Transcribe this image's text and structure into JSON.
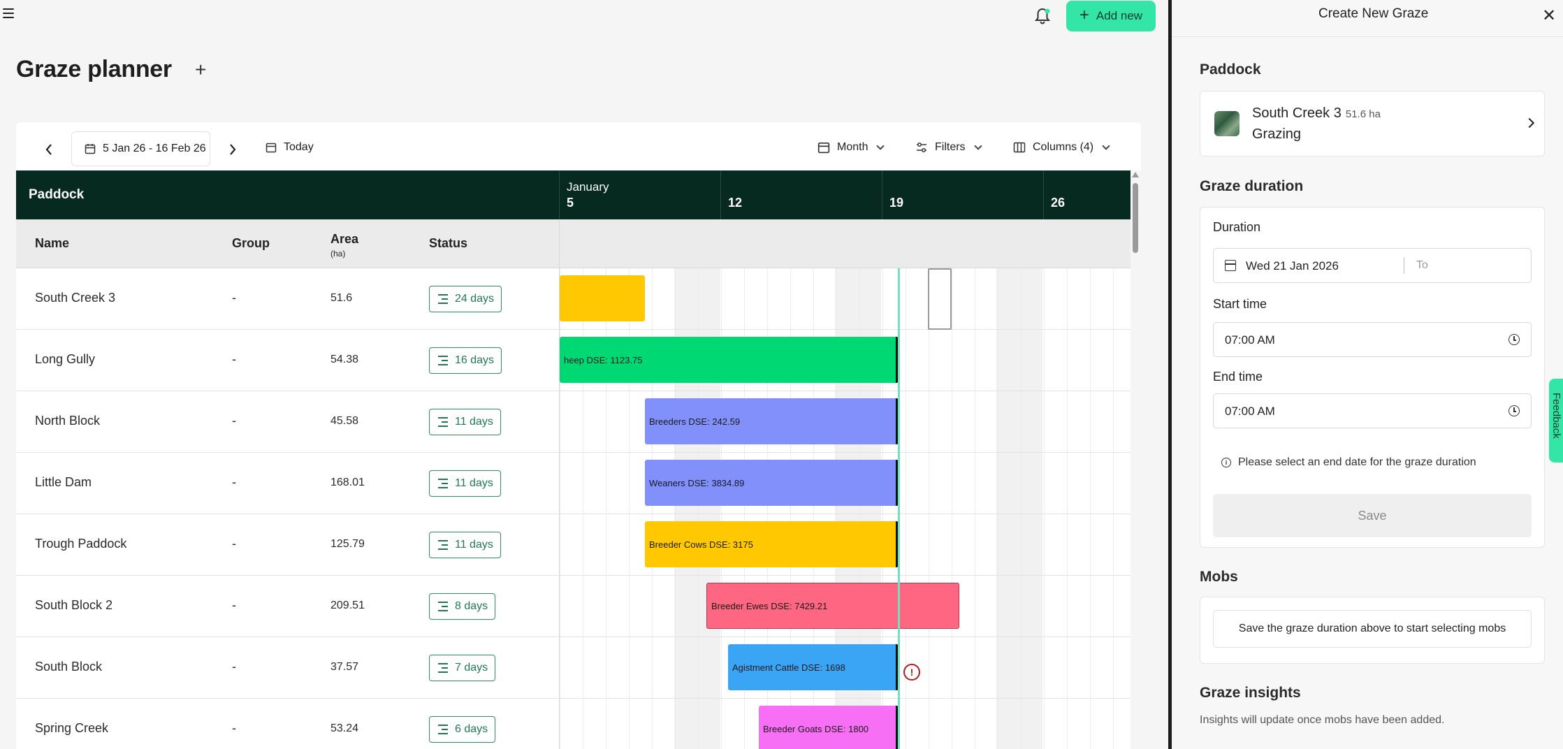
{
  "topbar": {
    "add_new_label": "Add new"
  },
  "page": {
    "title": "Graze planner"
  },
  "toolbar": {
    "date_range": "5 Jan 26 - 16 Feb 26",
    "today_label": "Today",
    "view_label": "Month",
    "filters_label": "Filters",
    "columns_label": "Columns (4)"
  },
  "grid": {
    "group_header": "Paddock",
    "month": "January",
    "weeks": [
      "5",
      "12",
      "19",
      "26"
    ],
    "columns": {
      "name": "Name",
      "group": "Group",
      "area": "Area",
      "area_unit": "(ha)",
      "status": "Status"
    },
    "rows": [
      {
        "name": "South Creek 3",
        "group": "-",
        "area": "51.6",
        "status": "24 days"
      },
      {
        "name": "Long Gully",
        "group": "-",
        "area": "54.38",
        "status": "16 days"
      },
      {
        "name": "North Block",
        "group": "-",
        "area": "45.58",
        "status": "11 days"
      },
      {
        "name": "Little Dam",
        "group": "-",
        "area": "168.01",
        "status": "11 days"
      },
      {
        "name": "Trough Paddock",
        "group": "-",
        "area": "125.79",
        "status": "11 days"
      },
      {
        "name": "South Block 2",
        "group": "-",
        "area": "209.51",
        "status": "8 days"
      },
      {
        "name": "South Block",
        "group": "-",
        "area": "37.57",
        "status": "7 days"
      },
      {
        "name": "Spring Creek",
        "group": "-",
        "area": "53.24",
        "status": "6 days"
      }
    ],
    "bars": [
      {
        "label": "",
        "color": "#ffc800"
      },
      {
        "label": "heep DSE: 1123.75",
        "color": "#00d873"
      },
      {
        "label": "Breeders DSE: 242.59",
        "color": "#8190fb"
      },
      {
        "label": "Weaners DSE: 3834.89",
        "color": "#8190fb"
      },
      {
        "label": "Breeder Cows DSE: 3175",
        "color": "#ffc800"
      },
      {
        "label": "Breeder Ewes DSE: 7429.21",
        "color": "#ff6681"
      },
      {
        "label": "Agistment Cattle DSE: 1698",
        "color": "#3ba5f5"
      },
      {
        "label": "Breeder Goats DSE: 1800",
        "color": "#f76ff5"
      }
    ]
  },
  "panel": {
    "title": "Create New Graze",
    "paddock_section": "Paddock",
    "paddock_name": "South Creek 3",
    "paddock_area": "51.6 ha",
    "paddock_status": "Grazing",
    "duration_section": "Graze duration",
    "duration_label": "Duration",
    "start_date": "Wed 21 Jan 2026",
    "end_placeholder": "To",
    "start_time_label": "Start time",
    "start_time": "07:00 AM",
    "end_time_label": "End time",
    "end_time": "07:00 AM",
    "info_text": "Please select an end date for the graze duration",
    "save_label": "Save",
    "mobs_section": "Mobs",
    "mobs_text": "Save the graze duration above to start selecting mobs",
    "insights_section": "Graze insights",
    "insights_text": "Insights will update once mobs have been added.",
    "feedback_label": "Feedback"
  }
}
